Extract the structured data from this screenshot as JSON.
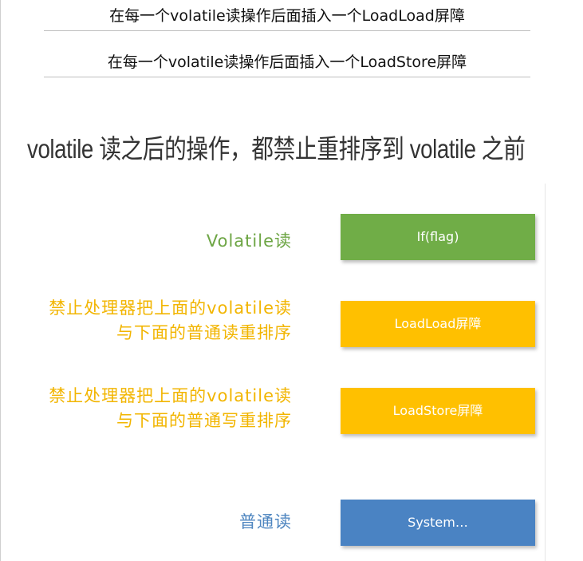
{
  "notes": [
    "在每一个volatile读操作后面插入一个LoadLoad屏障",
    "在每一个volatile读操作后面插入一个LoadStore屏障"
  ],
  "heading": "volatile 读之后的操作，都禁止重排序到 volatile 之前",
  "rows": [
    {
      "label_lines": [
        "Volatile读"
      ],
      "box": "If(flag)"
    },
    {
      "label_lines": [
        "禁止处理器把上面的volatile读",
        "与下面的普通读重排序"
      ],
      "box": "LoadLoad屏障"
    },
    {
      "label_lines": [
        "禁止处理器把上面的volatile读",
        "与下面的普通写重排序"
      ],
      "box": "LoadStore屏障"
    },
    {
      "label_lines": [
        "普通读"
      ],
      "box": "System…"
    }
  ],
  "colors": {
    "green": "#70ad47",
    "orange": "#ffc000",
    "blue": "#4a83c3",
    "label_green": "#6da544",
    "label_orange": "#f2b500",
    "label_blue": "#4f86c0"
  }
}
